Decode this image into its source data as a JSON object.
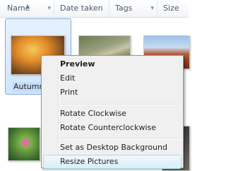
{
  "columns": {
    "name": "Name",
    "date_taken": "Date taken",
    "tags": "Tags",
    "size": "Size"
  },
  "items": {
    "selected_label": "Autumn"
  },
  "context_menu": {
    "preview": "Preview",
    "edit": "Edit",
    "print": "Print",
    "rotate_cw": "Rotate Clockwise",
    "rotate_ccw": "Rotate Counterclockwise",
    "set_background": "Set as Desktop Background",
    "resize": "Resize Pictures"
  },
  "icons": {
    "sort": "sort-ascending-icon",
    "column_menu": "chevron-down-icon"
  }
}
